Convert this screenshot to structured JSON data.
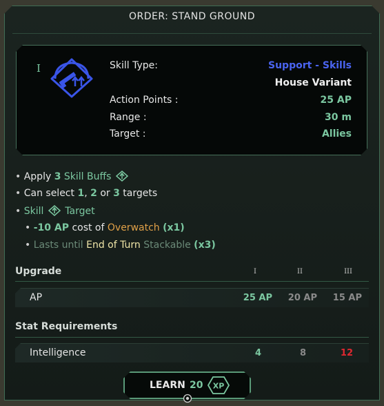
{
  "panel": {
    "title": "ORDER: STAND GROUND"
  },
  "skill": {
    "rank": "I",
    "icon": "support-skill-icon",
    "rows": [
      {
        "label": "Skill Type:",
        "value": "Support - Skills"
      },
      {
        "label": "",
        "value": "House Variant"
      },
      {
        "label": "Action Points :",
        "value": "25 AP"
      },
      {
        "label": "Range :",
        "value": "30 m"
      },
      {
        "label": "Target :",
        "value": "Allies"
      }
    ]
  },
  "effects": {
    "line1": {
      "bullet": "•",
      "text": "Apply",
      "num": "3",
      "tag": "Skill Buffs"
    },
    "line2": {
      "bullet": "•",
      "text": "Can select",
      "n1": "1",
      "sep1": ",",
      "n2": "2",
      "or": "or",
      "n3": "3",
      "tail": "targets"
    },
    "line3": {
      "bullet": "•",
      "a": "Skill",
      "b": "Target"
    },
    "line4": {
      "bullet": "•",
      "ap": "-10 AP",
      "text": "cost of",
      "skill": "Overwatch",
      "mult": "(x1)"
    },
    "line5": {
      "bullet": "•",
      "a": "Lasts until",
      "b": "End of Turn",
      "c": "Stackable",
      "mult": "(x3)"
    }
  },
  "upgrade": {
    "title": "Upgrade",
    "columns": [
      "I",
      "II",
      "III"
    ],
    "row": {
      "label": "AP",
      "values": [
        "25 AP",
        "20 AP",
        "15 AP"
      ]
    }
  },
  "stats": {
    "title": "Stat Requirements",
    "row": {
      "label": "Intelligence",
      "values": [
        "4",
        "8",
        "12"
      ]
    }
  },
  "learn": {
    "label": "LEARN",
    "cost": "20",
    "unit": "XP"
  },
  "colors": {
    "accent_green": "#7bc7a0",
    "skill_type_blue": "#4a64f0",
    "overwatch_orange": "#e0a048",
    "requirement_unmet_red": "#e02830",
    "muted": "#8a8a8a"
  }
}
